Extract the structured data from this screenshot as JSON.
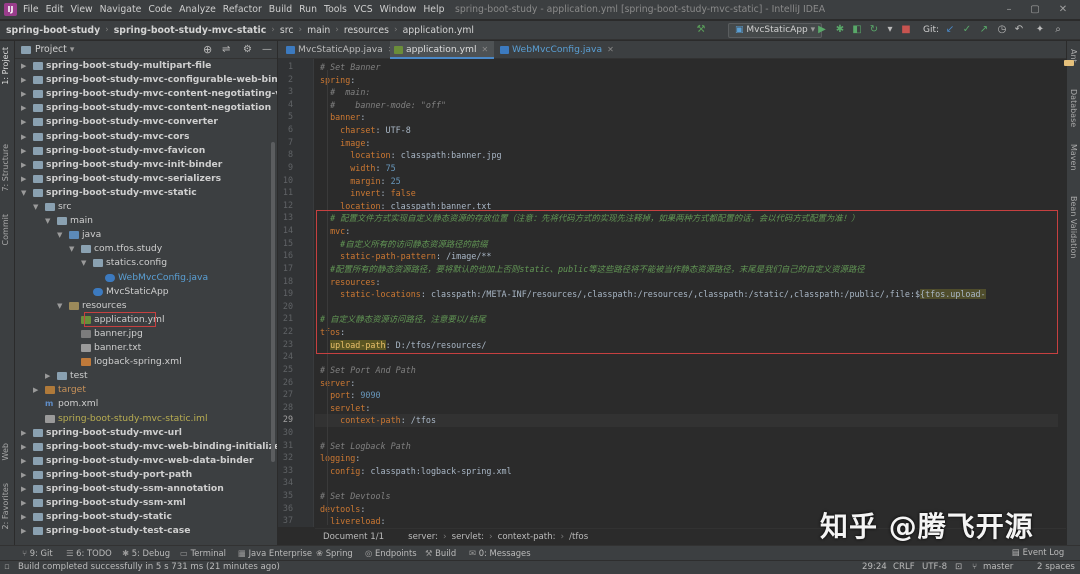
{
  "menubar": {
    "items": [
      "File",
      "Edit",
      "View",
      "Navigate",
      "Code",
      "Analyze",
      "Refactor",
      "Build",
      "Run",
      "Tools",
      "VCS",
      "Window",
      "Help"
    ],
    "window_title": "spring-boot-study - application.yml [spring-boot-study-mvc-static] - IntelliJ IDEA"
  },
  "navbar": {
    "crumbs": [
      "spring-boot-study",
      "spring-boot-study-mvc-static",
      "src",
      "main",
      "resources",
      "application.yml"
    ],
    "run_config": "MvcStaticApp",
    "git_label": "Git:"
  },
  "leftstrip": {
    "items": [
      "1: Project",
      "7: Structure",
      "Commit",
      "Web",
      "2: Favorites"
    ]
  },
  "rightstrip": {
    "items": [
      "Ant",
      "Database",
      "Maven",
      "Bean Validation"
    ]
  },
  "project_panel": {
    "title": "Project"
  },
  "tree": [
    {
      "label": "spring-boot-study-multipart-file",
      "bold": true,
      "indent": 0,
      "icon": "fold",
      "arrow": "▶"
    },
    {
      "label": "spring-boot-study-mvc-configurable-web-binding-",
      "bold": true,
      "indent": 0,
      "icon": "fold",
      "arrow": "▶"
    },
    {
      "label": "spring-boot-study-mvc-content-negotiating-view-r",
      "bold": true,
      "indent": 0,
      "icon": "fold",
      "arrow": "▶"
    },
    {
      "label": "spring-boot-study-mvc-content-negotiation",
      "bold": true,
      "indent": 0,
      "icon": "fold",
      "arrow": "▶"
    },
    {
      "label": "spring-boot-study-mvc-converter",
      "bold": true,
      "indent": 0,
      "icon": "fold",
      "arrow": "▶"
    },
    {
      "label": "spring-boot-study-mvc-cors",
      "bold": true,
      "indent": 0,
      "icon": "fold",
      "arrow": "▶"
    },
    {
      "label": "spring-boot-study-mvc-favicon",
      "bold": true,
      "indent": 0,
      "icon": "fold",
      "arrow": "▶"
    },
    {
      "label": "spring-boot-study-mvc-init-binder",
      "bold": true,
      "indent": 0,
      "icon": "fold",
      "arrow": "▶"
    },
    {
      "label": "spring-boot-study-mvc-serializers",
      "bold": true,
      "indent": 0,
      "icon": "fold",
      "arrow": "▶"
    },
    {
      "label": "spring-boot-study-mvc-static",
      "bold": true,
      "indent": 0,
      "icon": "fold",
      "arrow": "▼"
    },
    {
      "label": "src",
      "bold": false,
      "indent": 1,
      "icon": "fold",
      "arrow": "▼"
    },
    {
      "label": "main",
      "bold": false,
      "indent": 2,
      "icon": "fold",
      "arrow": "▼"
    },
    {
      "label": "java",
      "bold": false,
      "indent": 3,
      "icon": "foldsrc",
      "arrow": "▼"
    },
    {
      "label": "com.tfos.study",
      "bold": false,
      "indent": 4,
      "icon": "fold",
      "arrow": "▼"
    },
    {
      "label": "statics.config",
      "bold": false,
      "indent": 5,
      "icon": "fold",
      "arrow": "▼"
    },
    {
      "label": "WebMvcConfig.java",
      "bold": false,
      "indent": 6,
      "icon": "cls",
      "arrow": "",
      "color": "#5a9fd4"
    },
    {
      "label": "MvcStaticApp",
      "bold": false,
      "indent": 5,
      "icon": "cls",
      "arrow": ""
    },
    {
      "label": "resources",
      "bold": false,
      "indent": 3,
      "icon": "foldres",
      "arrow": "▼"
    },
    {
      "label": "application.yml",
      "bold": false,
      "indent": 4,
      "icon": "yml",
      "arrow": ""
    },
    {
      "label": "banner.jpg",
      "bold": false,
      "indent": 4,
      "icon": "img",
      "arrow": ""
    },
    {
      "label": "banner.txt",
      "bold": false,
      "indent": 4,
      "icon": "txt",
      "arrow": ""
    },
    {
      "label": "logback-spring.xml",
      "bold": false,
      "indent": 4,
      "icon": "xml",
      "arrow": ""
    },
    {
      "label": "test",
      "bold": false,
      "indent": 2,
      "icon": "fold",
      "arrow": "▶"
    },
    {
      "label": "target",
      "bold": false,
      "indent": 1,
      "icon": "foldtgt",
      "arrow": "▶",
      "color": "#c8925a"
    },
    {
      "label": "pom.xml",
      "bold": false,
      "indent": 1,
      "icon": "mvn",
      "arrow": ""
    },
    {
      "label": "spring-boot-study-mvc-static.iml",
      "bold": false,
      "indent": 1,
      "icon": "txt",
      "arrow": "",
      "color": "#b9ae52"
    },
    {
      "label": "spring-boot-study-mvc-url",
      "bold": true,
      "indent": 0,
      "icon": "fold",
      "arrow": "▶"
    },
    {
      "label": "spring-boot-study-mvc-web-binding-initializer",
      "bold": true,
      "indent": 0,
      "icon": "fold",
      "arrow": "▶"
    },
    {
      "label": "spring-boot-study-mvc-web-data-binder",
      "bold": true,
      "indent": 0,
      "icon": "fold",
      "arrow": "▶"
    },
    {
      "label": "spring-boot-study-port-path",
      "bold": true,
      "indent": 0,
      "icon": "fold",
      "arrow": "▶"
    },
    {
      "label": "spring-boot-study-ssm-annotation",
      "bold": true,
      "indent": 0,
      "icon": "fold",
      "arrow": "▶"
    },
    {
      "label": "spring-boot-study-ssm-xml",
      "bold": true,
      "indent": 0,
      "icon": "fold",
      "arrow": "▶"
    },
    {
      "label": "spring-boot-study-static",
      "bold": true,
      "indent": 0,
      "icon": "fold",
      "arrow": "▶"
    },
    {
      "label": "spring-boot-study-test-case",
      "bold": true,
      "indent": 0,
      "icon": "fold",
      "arrow": "▶"
    }
  ],
  "tabs": [
    {
      "label": "MvcStaticApp.java",
      "active": false,
      "icon": "cls"
    },
    {
      "label": "application.yml",
      "active": true,
      "icon": "yml"
    },
    {
      "label": "WebMvcConfig.java",
      "active": false,
      "icon": "cls"
    }
  ],
  "editor": {
    "current_line": 29,
    "lines": [
      {
        "n": 1,
        "html": "<span class='cm'># Set Banner</span>"
      },
      {
        "n": 2,
        "html": "<span class='k'>spring</span>:"
      },
      {
        "n": 3,
        "html": "  <span class='cm'>#  main:</span>"
      },
      {
        "n": 4,
        "html": "  <span class='cm'>#    banner-mode: \"off\"</span>"
      },
      {
        "n": 5,
        "html": "  <span class='k'>banner</span>:"
      },
      {
        "n": 6,
        "html": "    <span class='k'>charset</span>: UTF-8"
      },
      {
        "n": 7,
        "html": "    <span class='k'>image</span>:"
      },
      {
        "n": 8,
        "html": "      <span class='k'>location</span>: classpath:banner.jpg"
      },
      {
        "n": 9,
        "html": "      <span class='k'>width</span>: <span class='n'>75</span>"
      },
      {
        "n": 10,
        "html": "      <span class='k'>margin</span>: <span class='n'>25</span>"
      },
      {
        "n": 11,
        "html": "      <span class='k'>invert</span>: <span class='k'>false</span>"
      },
      {
        "n": 12,
        "html": "    <span class='k'>location</span>: classpath:banner.txt"
      },
      {
        "n": 13,
        "html": "  <span class='cmz'># 配置文件方式实现自定义静态资源的存放位置（注意：先将代码方式的实现先注释掉，如果两种方式都配置的话，会以代码方式配置为准！）</span>"
      },
      {
        "n": 14,
        "html": "  <span class='k'>mvc</span>:"
      },
      {
        "n": 15,
        "html": "    <span class='cmz'>#自定义所有的访问静态资源路径的前缀</span>"
      },
      {
        "n": 16,
        "html": "    <span class='k'>static-path-pattern</span>: /image/**"
      },
      {
        "n": 17,
        "html": "  <span class='cmz'>#配置所有的静态资源路径，要将默认的也加上否则static、public等这些路径将不能被当作静态资源路径，末尾是我们自己的自定义资源路径</span>"
      },
      {
        "n": 18,
        "html": "  <span class='k'>resources</span>:"
      },
      {
        "n": 19,
        "html": "    <span class='k'>static-locations</span>: classpath:/META-INF/resources/,classpath:/resources/,classpath:/static/,classpath:/public/,file:$<span class='y'>{tfos.upload-</span>"
      },
      {
        "n": 20,
        "html": ""
      },
      {
        "n": 21,
        "html": "<span class='cmz'># 自定义静态资源访问路径，注意要以/结尾</span>"
      },
      {
        "n": 22,
        "html": "<span class='k'>tfos</span>:"
      },
      {
        "n": 23,
        "html": "  <span class='hl'>upload-path</span>: D:/tfos/resources/"
      },
      {
        "n": 24,
        "html": ""
      },
      {
        "n": 25,
        "html": "<span class='cm'># Set Port And Path</span>"
      },
      {
        "n": 26,
        "html": "<span class='k'>server</span>:"
      },
      {
        "n": 27,
        "html": "  <span class='k'>port</span>: <span class='n'>9090</span>"
      },
      {
        "n": 28,
        "html": "  <span class='k'>servlet</span>:"
      },
      {
        "n": 29,
        "html": "    <span class='k'>context-path</span>: /tfos"
      },
      {
        "n": 30,
        "html": ""
      },
      {
        "n": 31,
        "html": "<span class='cm'># Set Logback Path</span>"
      },
      {
        "n": 32,
        "html": "<span class='k'>logging</span>:"
      },
      {
        "n": 33,
        "html": "  <span class='k'>config</span>: classpath:logback-spring.xml"
      },
      {
        "n": 34,
        "html": ""
      },
      {
        "n": 35,
        "html": "<span class='cm'># Set Devtools</span>"
      },
      {
        "n": 36,
        "html": "<span class='k'>devtools</span>:"
      },
      {
        "n": 37,
        "html": "  <span class='k'>livereload</span>:"
      }
    ]
  },
  "breadcrumb_bar": [
    "Document 1/1",
    "server:",
    "servlet:",
    "context-path:",
    "/tfos"
  ],
  "toolwindows": [
    "9: Git",
    "6: TODO",
    "5: Debug",
    "Terminal",
    "Java Enterprise",
    "Spring",
    "Endpoints",
    "Build",
    "0: Messages"
  ],
  "event_log": "Event Log",
  "status": {
    "message": "Build completed successfully in 5 s 731 ms (21 minutes ago)",
    "position": "29:24",
    "line_sep": "CRLF",
    "encoding": "UTF-8",
    "indent": "2 spaces",
    "branch": "master"
  },
  "watermark": "知乎 @腾飞开源",
  "colors": {
    "accent": "#4a88c7",
    "highlight_box": "#c64040",
    "bg": "#2b2b2b",
    "panel": "#3c3f41"
  }
}
